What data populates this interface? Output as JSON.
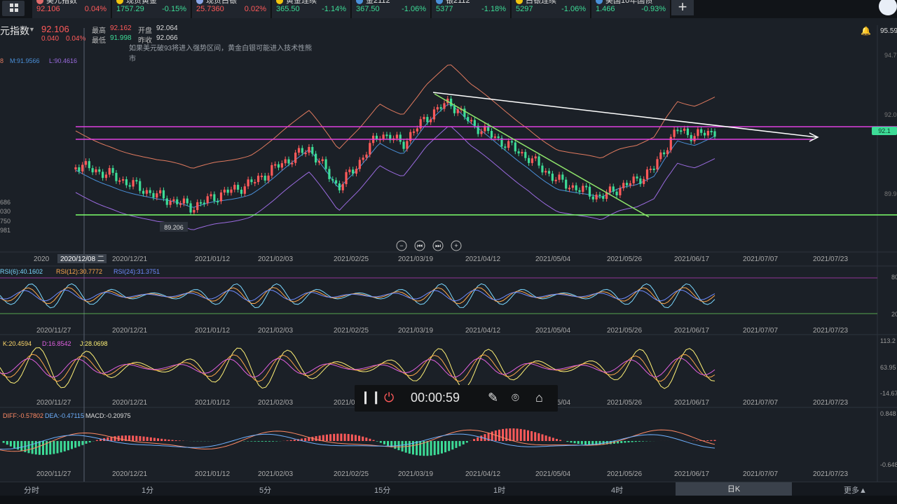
{
  "tickers": [
    {
      "name": "美元指数",
      "price": "92.106",
      "change": "0.04%",
      "dot": "#e06b6b",
      "pcolor": "#ff5a5a",
      "ccolor": "#ff5a5a"
    },
    {
      "name": "现货黄金",
      "price": "1757.29",
      "change": "-0.15%",
      "dot": "#f1c40f",
      "pcolor": "#3ddc97",
      "ccolor": "#3ddc97"
    },
    {
      "name": "现货白银",
      "price": "25.7360",
      "change": "0.02%",
      "dot": "#8aa6e6",
      "pcolor": "#ff5a5a",
      "ccolor": "#ff5a5a"
    },
    {
      "name": "黄金连续",
      "price": "365.50",
      "change": "-1.14%",
      "dot": "#f1c40f",
      "pcolor": "#3ddc97",
      "ccolor": "#3ddc97"
    },
    {
      "name": "金2112",
      "price": "367.50",
      "change": "-1.06%",
      "dot": "#4a90d9",
      "pcolor": "#3ddc97",
      "ccolor": "#3ddc97"
    },
    {
      "name": "银2112",
      "price": "5377",
      "change": "-1.18%",
      "dot": "#4a90d9",
      "pcolor": "#3ddc97",
      "ccolor": "#3ddc97"
    },
    {
      "name": "白银连续",
      "price": "5297",
      "change": "-1.06%",
      "dot": "#f1c40f",
      "pcolor": "#3ddc97",
      "ccolor": "#3ddc97"
    },
    {
      "name": "美国10年国债",
      "price": "1.466",
      "change": "-0.93%",
      "dot": "#4a90d9",
      "pcolor": "#3ddc97",
      "ccolor": "#3ddc97"
    }
  ],
  "header": {
    "title": "元指数",
    "price": "92.106",
    "change_abs": "0.040",
    "change_pct": "0.04%",
    "high_label": "最高",
    "high": "92.162",
    "open_label": "开盘",
    "open": "92.064",
    "low_label": "最低",
    "low": "91.998",
    "prev_label": "昨收",
    "prev": "92.066",
    "right_value": "95.59"
  },
  "annotation": "如果美元破93将进入强势区间，黄金白银可能进入技术性熊市",
  "boll_legend": {
    "m": "M:91.9566",
    "l": "L:90.4616",
    "prefix": "8"
  },
  "price_axis": [
    "94.7",
    "92.0",
    "89.9"
  ],
  "left_axis": [
    "686",
    "030",
    "750",
    "981"
  ],
  "low_marker": "89.206",
  "price_tag": "92.1",
  "x_dates": [
    "2020/11/27",
    "2020/12/21",
    "2021/01/12",
    "2021/02/03",
    "2021/02/25",
    "2021/03/19",
    "2021/04/12",
    "2021/05/04",
    "2021/05/26",
    "2021/06/17",
    "2021/07/07",
    "2021/07/23"
  ],
  "crosshair_date": "2020/12/08 二",
  "rsi": {
    "r6": "RSI(6):40.1602",
    "r12": "RSI(12):30.7772",
    "r24": "RSI(24):31.3751",
    "top": "80",
    "bottom": "20"
  },
  "kdj": {
    "k": "K:20.4594",
    "d": "D:16.8542",
    "j": "J:28.0698",
    "axis": [
      "113.2",
      "63.95",
      "-14.67"
    ]
  },
  "macd": {
    "diff": "DIFF:-0.57802",
    "dea": "DEA:-0.47115",
    "macd": "MACD:-0.20975",
    "axis": [
      "0.848",
      "-0.648"
    ]
  },
  "recorder": {
    "time": "00:00:59"
  },
  "bottom_nav": [
    "分时",
    "1分",
    "5分",
    "15分",
    "1时",
    "4时",
    "日K",
    "更多▲"
  ],
  "colors": {
    "up": "#ff5a5a",
    "down": "#3ddc97",
    "magenta": "#e040e0",
    "white": "#ffffff",
    "green_line": "#7dff6b",
    "boll_upper": "#e07a5f",
    "boll_mid": "#4a90d9",
    "boll_lower": "#9b6be0"
  }
}
